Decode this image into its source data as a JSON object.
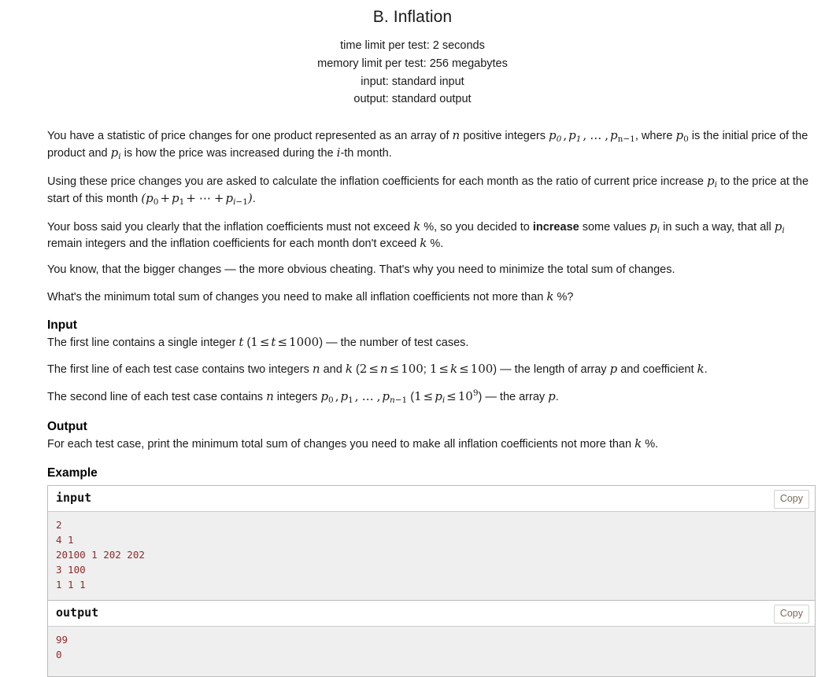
{
  "problem": {
    "title": "B. Inflation",
    "limits": {
      "time": "time limit per test: 2 seconds",
      "memory": "memory limit per test: 256 megabytes",
      "input": "input: standard input",
      "output": "output: standard output"
    },
    "statement": {
      "p1_a": "You have a statistic of price changes for one product represented as an array of ",
      "p1_n": "n",
      "p1_b": " positive integers ",
      "p1_c": ", where ",
      "p1_d": " is the initial price of the product and ",
      "p1_e": " is how the price was increased during the ",
      "p1_i": "i",
      "p1_f": "-th month.",
      "p2_a": "Using these price changes you are asked to calculate the inflation coefficients for each month as the ratio of current price increase ",
      "p2_b": " to the price at the start of this month ",
      "p2_c": ".",
      "p3_a": "Your boss said you clearly that the inflation coefficients must not exceed ",
      "p3_k": "k",
      "p3_b": " %, so you decided to ",
      "p3_bold": "increase",
      "p3_c": " some values ",
      "p3_d": " in such a way, that all ",
      "p3_e": " remain integers and the inflation coefficients for each month don't exceed ",
      "p3_f": " %.",
      "p4": "You know, that the bigger changes — the more obvious cheating. That's why you need to minimize the total sum of changes.",
      "p5_a": "What's the minimum total sum of changes you need to make all inflation coefficients not more than ",
      "p5_b": " %?"
    },
    "input_section": {
      "heading": "Input",
      "l1_a": "The first line contains a single integer ",
      "l1_t": "t",
      "l1_b": " (",
      "l1_range": "1 ≤ t ≤ 1000",
      "l1_c": ") — the number of test cases.",
      "l2_a": "The first line of each test case contains two integers ",
      "l2_n": "n",
      "l2_b": " and ",
      "l2_k": "k",
      "l2_c": " (",
      "l2_range_n": "2 ≤ n ≤ 100",
      "l2_semi": "; ",
      "l2_range_k": "1 ≤ k ≤ 100",
      "l2_d": ") — the length of array ",
      "l2_p": "p",
      "l2_e": " and coefficient ",
      "l2_f": ".",
      "l3_a": "The second line of each test case contains ",
      "l3_n": "n",
      "l3_b": " integers ",
      "l3_c": " (",
      "l3_d": ") — the array ",
      "l3_p": "p",
      "l3_e": "."
    },
    "output_section": {
      "heading": "Output",
      "text_a": "For each test case, print the minimum total sum of changes you need to make all inflation coefficients not more than ",
      "text_k": "k",
      "text_b": " %."
    },
    "example": {
      "heading": "Example",
      "input_label": "input",
      "output_label": "output",
      "copy_label": "Copy",
      "input_data": "2\n4 1\n20100 1 202 202\n3 100\n1 1 1",
      "output_data": "99\n0"
    },
    "math": {
      "p_array": "p0, p1, …, pn−1",
      "p_i": "pi",
      "p_0": "p0",
      "sum_expr": "(p0 + p1 + ⋯ + pi−1)",
      "p_bound": "1 ≤ pi ≤ 10^9"
    },
    "colors": {
      "text": "#1a1a1a",
      "sample_bg": "#efefef",
      "sample_text": "#8d2b2b",
      "border": "#bbbbbb",
      "copy_text": "#7a6a5a"
    }
  }
}
